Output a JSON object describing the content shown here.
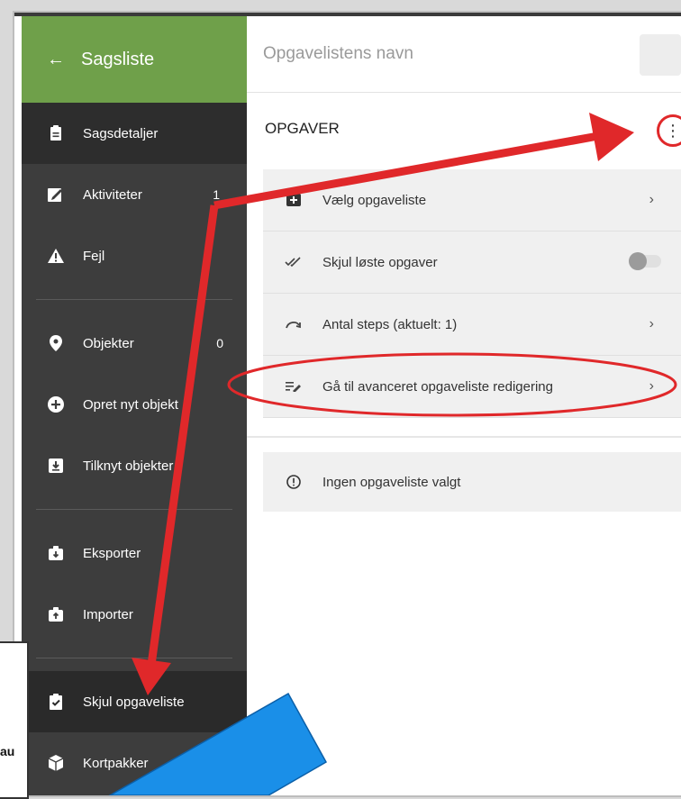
{
  "sidebar": {
    "back_label": "Sagsliste",
    "items": [
      {
        "label": "Sagsdetaljer"
      },
      {
        "label": "Aktiviteter",
        "count": "1"
      },
      {
        "label": "Fejl"
      },
      {
        "label": "Objekter",
        "count": "0"
      },
      {
        "label": "Opret nyt objekt"
      },
      {
        "label": "Tilknyt objekter"
      },
      {
        "label": "Eksporter"
      },
      {
        "label": "Importer"
      },
      {
        "label": "Skjul opgaveliste"
      },
      {
        "label": "Kortpakker"
      }
    ]
  },
  "main": {
    "name_placeholder": "Opgavelistens navn",
    "section_title": "OPGAVER",
    "menu": [
      {
        "label": "Vælg opgaveliste",
        "icon": "list-add-icon",
        "control": "chevron"
      },
      {
        "label": "Skjul løste opgaver",
        "icon": "double-check-icon",
        "control": "toggle",
        "toggle_on": false
      },
      {
        "label": "Antal steps (aktuelt: 1)",
        "icon": "redo-arrow-icon",
        "control": "chevron"
      },
      {
        "label": "Gå til avanceret opgaveliste redigering",
        "icon": "edit-list-icon",
        "control": "chevron"
      }
    ],
    "empty_message": "Ingen opgaveliste valgt"
  },
  "overlay": {
    "note_fragment": "au",
    "annotation_color": "#e0282a",
    "highlight_color": "#1a8fe8"
  },
  "colors": {
    "sidebar_header": "#6fa04a",
    "sidebar_bg": "#3d3d3d"
  }
}
